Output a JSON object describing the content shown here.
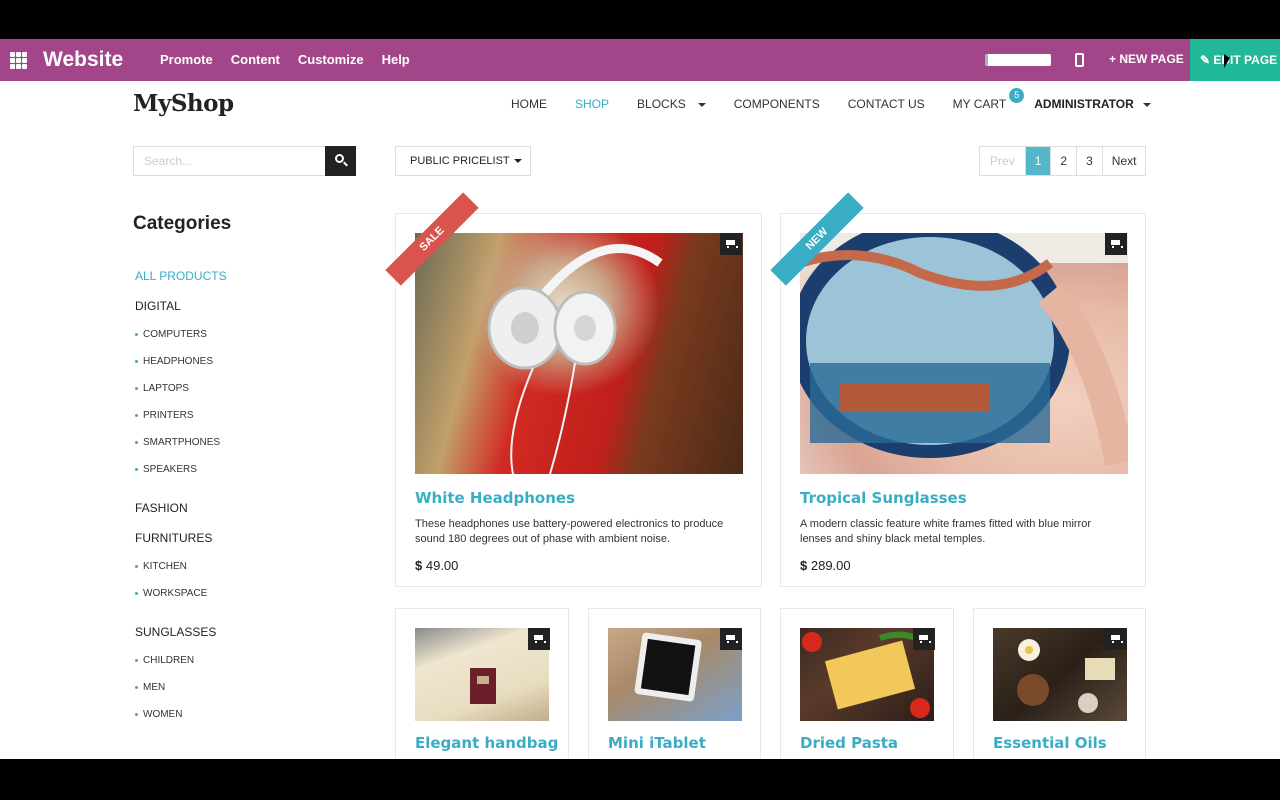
{
  "admin_bar": {
    "brand": "Website",
    "menu": [
      "Promote",
      "Content",
      "Customize",
      "Help"
    ],
    "new_page": "+ NEW PAGE",
    "edit_page": "✎ EDIT PAGE",
    "progress": 0.05,
    "colors": {
      "bar": "#a24689",
      "edit": "#21b799"
    }
  },
  "site": {
    "logo": "MyShop",
    "nav": {
      "home": "HOME",
      "shop": "SHOP",
      "blocks": "BLOCKS",
      "components": "COMPONENTS",
      "contact": "CONTACT US",
      "cart": "MY CART",
      "cart_count": "5",
      "user": "ADMINISTRATOR"
    }
  },
  "search": {
    "placeholder": "Search..."
  },
  "pricelist": {
    "label": "PUBLIC PRICELIST"
  },
  "pager": {
    "prev": "Prev",
    "pages": [
      "1",
      "2",
      "3"
    ],
    "next": "Next",
    "current": "1"
  },
  "categories": {
    "title": "Categories",
    "all": "ALL PRODUCTS",
    "digital": "DIGITAL",
    "digital_items": [
      "COMPUTERS",
      "HEADPHONES",
      "LAPTOPS",
      "PRINTERS",
      "SMARTPHONES",
      "SPEAKERS"
    ],
    "fashion": "FASHION",
    "furnitures": "FURNITURES",
    "furniture_items": [
      "KITCHEN",
      "WORKSPACE"
    ],
    "sunglasses": "SUNGLASSES",
    "sunglasses_items": [
      "CHILDREN",
      "MEN",
      "WOMEN"
    ]
  },
  "products": [
    {
      "name": "White Headphones",
      "ribbon": "SALE",
      "description": "These headphones use battery-powered electronics to produce sound 180 degrees out of phase with ambient noise.",
      "currency": "$",
      "price": "49.00"
    },
    {
      "name": "Tropical Sunglasses",
      "ribbon": "NEW",
      "description": "A modern classic feature white frames fitted with blue mirror lenses and shiny black metal temples.",
      "currency": "$",
      "price": "289.00"
    },
    {
      "name": "Elegant handbag"
    },
    {
      "name": "Mini iTablet"
    },
    {
      "name": "Dried Pasta"
    },
    {
      "name": "Essential Oils"
    }
  ],
  "ribbon_colors": {
    "sale": "#d9534f",
    "new": "#3aadc4"
  }
}
